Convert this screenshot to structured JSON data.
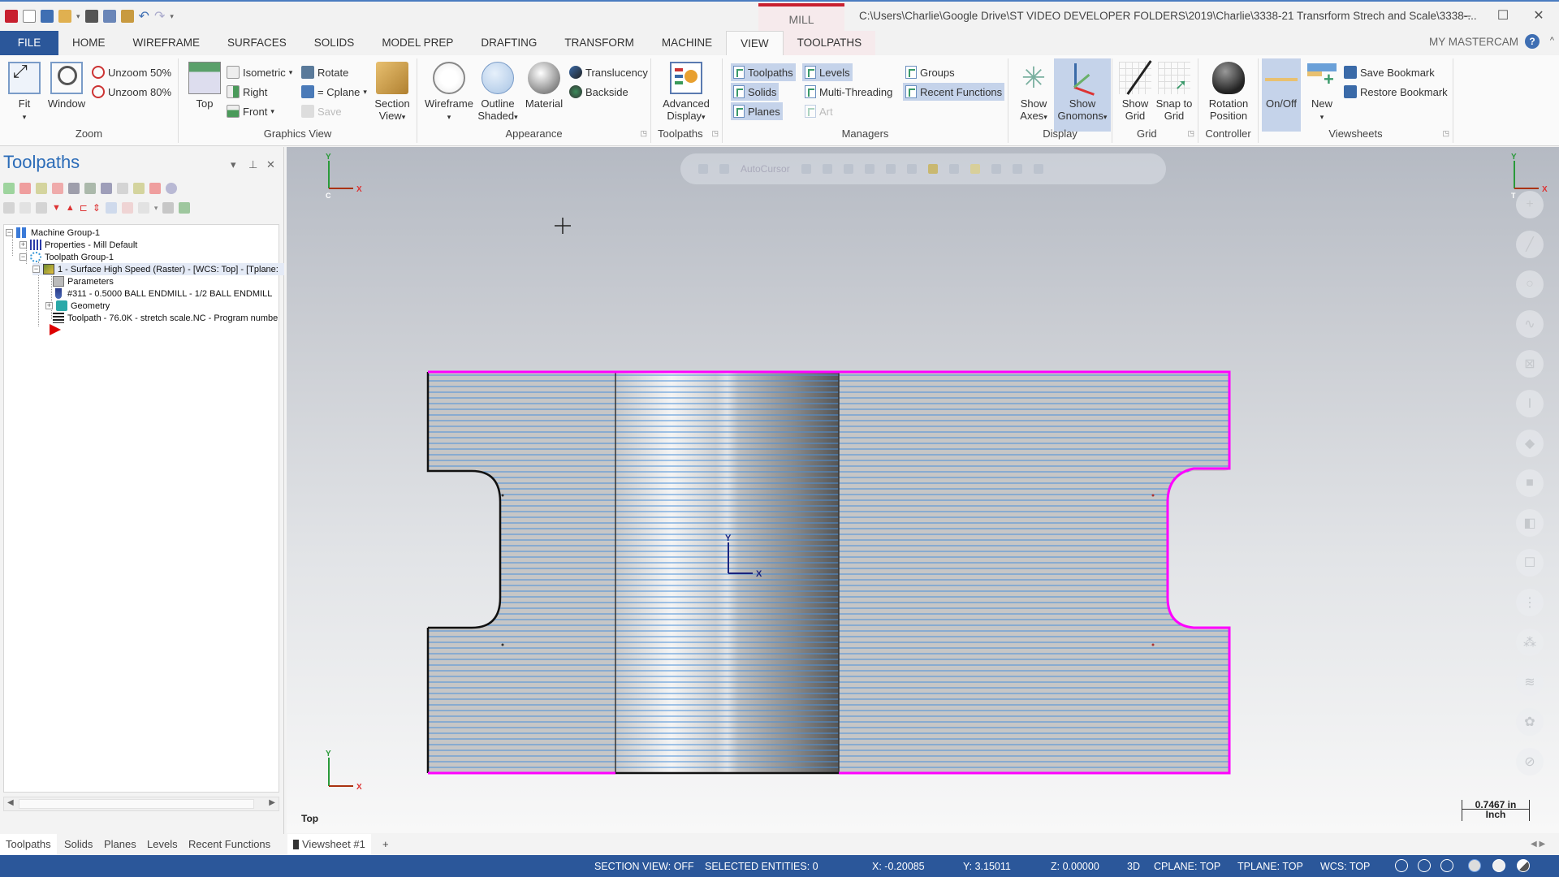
{
  "app": {
    "mill_tab": "MILL",
    "title_path": "C:\\Users\\Charlie\\Google Drive\\ST VIDEO DEVELOPER FOLDERS\\2019\\Charlie\\3338-21 Transrform Strech and Scale\\3338-...",
    "window_controls": {
      "minimize": "–",
      "maximize": "☐",
      "close": "✕"
    }
  },
  "tabs": [
    {
      "label": "FILE"
    },
    {
      "label": "HOME"
    },
    {
      "label": "WIREFRAME"
    },
    {
      "label": "SURFACES"
    },
    {
      "label": "SOLIDS"
    },
    {
      "label": "MODEL PREP"
    },
    {
      "label": "DRAFTING"
    },
    {
      "label": "TRANSFORM"
    },
    {
      "label": "MACHINE"
    },
    {
      "label": "VIEW"
    },
    {
      "label": "TOOLPATHS"
    }
  ],
  "active_tab": "VIEW",
  "my_mastercam": "MY MASTERCAM",
  "help": "?",
  "collapse": "^",
  "ribbon": {
    "zoom": {
      "label": "Zoom",
      "fit": "Fit",
      "window": "Window",
      "unzoom50": "Unzoom 50%",
      "unzoom80": "Unzoom 80%"
    },
    "graphics_view": {
      "label": "Graphics View",
      "top": "Top",
      "isometric": "Isometric",
      "right": "Right",
      "front": "Front",
      "rotate": "Rotate",
      "cplane": "= Cplane",
      "save": "Save",
      "section_view": "Section View"
    },
    "appearance": {
      "label": "Appearance",
      "wireframe": "Wireframe",
      "outline_shaded": "Outline Shaded",
      "material": "Material",
      "translucency": "Translucency",
      "backside": "Backside"
    },
    "toolpaths": {
      "label": "Toolpaths",
      "advanced_display": "Advanced Display"
    },
    "managers": {
      "label": "Managers",
      "toolpaths": "Toolpaths",
      "solids": "Solids",
      "planes": "Planes",
      "levels": "Levels",
      "multi_threading": "Multi-Threading",
      "art": "Art",
      "groups": "Groups",
      "recent_functions": "Recent Functions"
    },
    "display": {
      "label": "Display",
      "show_axes": "Show Axes",
      "show_gnomons": "Show Gnomons"
    },
    "grid": {
      "label": "Grid",
      "show_grid": "Show Grid",
      "snap_to_grid": "Snap to Grid"
    },
    "controller": {
      "label": "Controller",
      "rotation_position": "Rotation Position"
    },
    "viewsheets": {
      "label": "Viewsheets",
      "on_off": "On/Off",
      "new": "New",
      "save_bookmark": "Save Bookmark",
      "restore_bookmark": "Restore Bookmark"
    }
  },
  "panel": {
    "title": "Toolpaths",
    "tree": [
      {
        "label": "Machine Group-1",
        "level": 0,
        "expander": "−"
      },
      {
        "label": "Properties - Mill Default",
        "level": 1,
        "expander": "+"
      },
      {
        "label": "Toolpath Group-1",
        "level": 1,
        "expander": "−"
      },
      {
        "label": "1 - Surface High Speed (Raster) - [WCS: Top] - [Tplane: ",
        "level": 2,
        "expander": "−",
        "selected": true
      },
      {
        "label": "Parameters",
        "level": 3
      },
      {
        "label": "#311 - 0.5000 BALL ENDMILL - 1/2 BALL ENDMILL",
        "level": 3
      },
      {
        "label": "Geometry",
        "level": 3,
        "expander": "+"
      },
      {
        "label": "Toolpath - 76.0K - stretch scale.NC - Program numbe",
        "level": 3
      }
    ]
  },
  "bottom_tabs": [
    "Toolpaths",
    "Solids",
    "Planes",
    "Levels",
    "Recent Functions"
  ],
  "viewsheet_tab": "Viewsheet #1",
  "viewsheet_add": "+",
  "viewport": {
    "autocursor": "AutoCursor",
    "view_name": "Top",
    "scale_value": "0.7467 in",
    "scale_unit": "Inch",
    "gnomon_x": "X",
    "gnomon_y": "Y",
    "gnomon_c": "C",
    "gnomon_t": "T",
    "origin_x": "X",
    "origin_y": "Y"
  },
  "status": {
    "section_view": "SECTION VIEW: OFF",
    "selected": "SELECTED ENTITIES: 0",
    "x": "X:  -0.20085",
    "y": "Y:  3.15011",
    "z": "Z:  0.00000",
    "mode": "3D",
    "cplane": "CPLANE: TOP",
    "tplane": "TPLANE: TOP",
    "wcs": "WCS: TOP"
  },
  "colors": {
    "accent": "#2b579a",
    "mill_tab": "#c8202f",
    "chain_magenta": "#ff00ff",
    "toolpath_blue": "#4a90d9",
    "panel_title": "#2b6cb8"
  }
}
